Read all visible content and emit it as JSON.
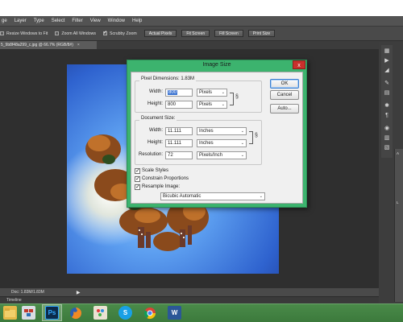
{
  "app": {
    "name": "Adobe Photoshop"
  },
  "menubar": [
    "ge",
    "Layer",
    "Type",
    "Select",
    "Filter",
    "View",
    "Window",
    "Help"
  ],
  "options_bar": {
    "resize_windows": "Resize Windows to Fit",
    "zoom_all_windows": "Zoom All Windows",
    "scrubby_zoom": "Scrubby Zoom",
    "actual_pixels": "Actual Pixels",
    "fit_screen": "Fit Screen",
    "fill_screen": "Fill Screen",
    "print_size": "Print Size"
  },
  "document_tab": {
    "title": "5_9b8f48a299_c.jpg @ 66.7% (RGB/8#)",
    "close": "×"
  },
  "status_bar": {
    "doc": "Doc: 1.83M/1.83M",
    "arrow": "▶"
  },
  "timeline": {
    "label": "Timeline"
  },
  "right_panel": {
    "labels": [
      "A",
      "L"
    ]
  },
  "dialog": {
    "title": "Image Size",
    "close": "x",
    "pixel_dimensions_label": "Pixel Dimensions:",
    "pixel_dimensions_value": "1.83M",
    "width_label": "Width:",
    "width_value": "800",
    "width_unit": "Pixels",
    "height_label": "Height:",
    "height_value": "800",
    "height_unit": "Pixels",
    "document_size_label": "Document Size:",
    "doc_width_label": "Width:",
    "doc_width_value": "11.111",
    "doc_width_unit": "Inches",
    "doc_height_label": "Height:",
    "doc_height_value": "11.111",
    "doc_height_unit": "Inches",
    "resolution_label": "Resolution:",
    "resolution_value": "72",
    "resolution_unit": "Pixels/Inch",
    "scale_styles": "Scale Styles",
    "constrain_proportions": "Constrain Proportions",
    "resample_image": "Resample Image:",
    "resample_method": "Bicubic Automatic",
    "ok": "OK",
    "cancel": "Cancel",
    "auto": "Auto..."
  },
  "taskbar": {
    "icons": [
      "file-explorer-icon",
      "network-icon",
      "photoshop-icon",
      "firefox-icon",
      "paint-icon",
      "skype-icon",
      "chrome-icon",
      "word-icon"
    ],
    "photoshop_label": "Ps",
    "skype_label": "S",
    "word_label": "W"
  },
  "colors": {
    "dialog_title_bar": "#3cb36e",
    "close_button": "#c9302c",
    "taskbar": "#3f7d3f",
    "workspace": "#2f2f2f"
  }
}
